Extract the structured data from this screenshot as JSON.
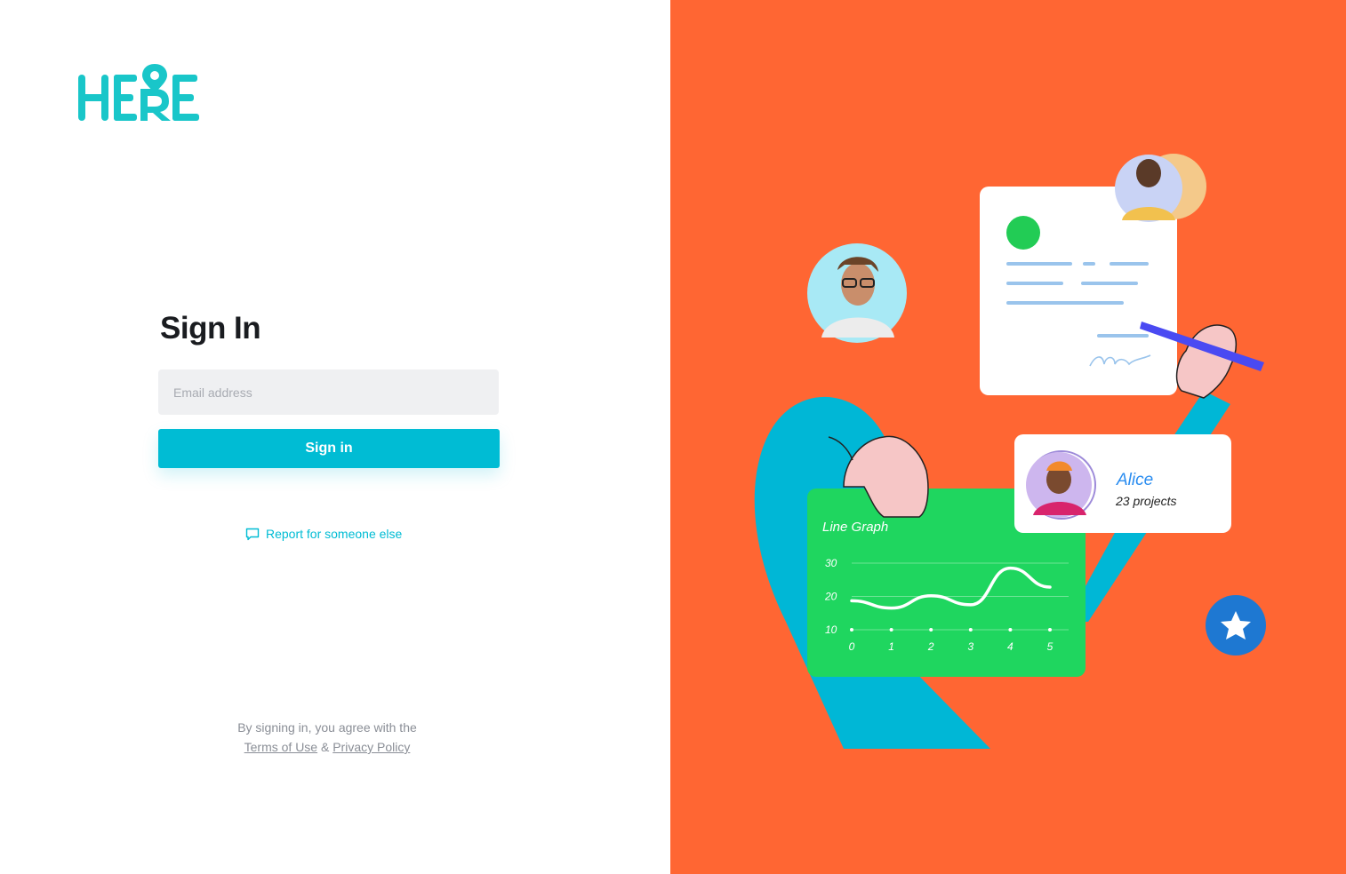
{
  "brand": {
    "name": "HERE",
    "color": "#19c6c9"
  },
  "signin": {
    "title": "Sign In",
    "email_placeholder": "Email address",
    "email_value": "",
    "button_label": "Sign in",
    "report_link": "Report for someone else",
    "report_icon": "message-icon"
  },
  "legal": {
    "prefix": "By signing in, you agree with the",
    "terms": "Terms of Use",
    "amp": "&",
    "privacy": "Privacy Policy"
  },
  "illustration": {
    "profile_name": "Alice",
    "profile_subtitle": "23 projects",
    "chart_title": "Line Graph",
    "badge_icon": "star-icon"
  },
  "chart_data": {
    "type": "line",
    "title": "Line Graph",
    "x_ticks": [
      "0",
      "1",
      "2",
      "3",
      "4",
      "5"
    ],
    "y_ticks": [
      "10",
      "20",
      "30"
    ],
    "ylim": [
      10,
      30
    ],
    "xlim": [
      0,
      5
    ],
    "series": [
      {
        "x": [
          0,
          1,
          2,
          3,
          4,
          5
        ],
        "values": [
          18.7,
          16.5,
          20.2,
          17.5,
          28.5,
          22.8
        ]
      }
    ]
  },
  "colors": {
    "accent": "#00bcd4",
    "panel_bg": "#ff6633",
    "chart_bg": "#1fd65f",
    "input_bg": "#eff0f2"
  }
}
